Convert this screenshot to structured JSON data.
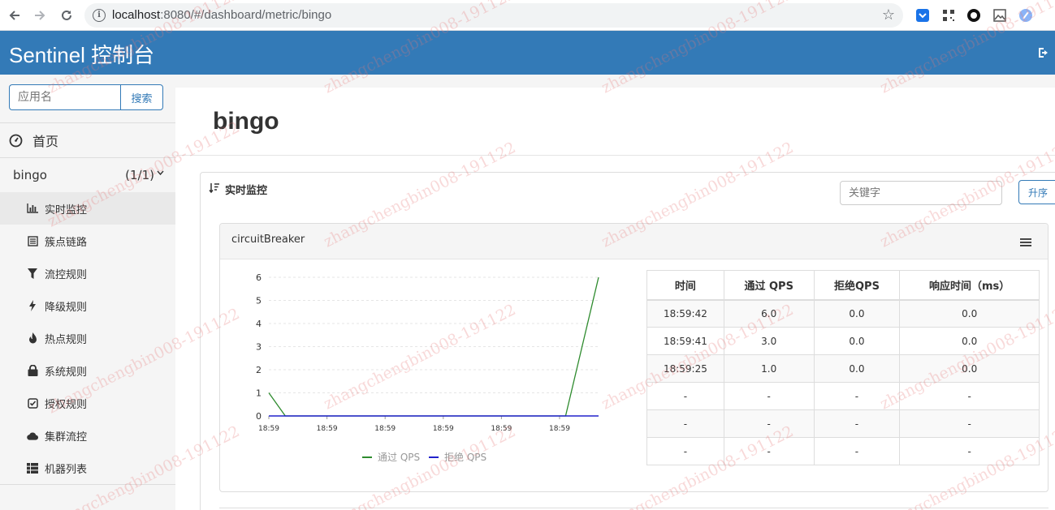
{
  "browser": {
    "url_host": "localhost",
    "url_rest": ":8080/#/dashboard/metric/bingo"
  },
  "header": {
    "title": "Sentinel 控制台"
  },
  "sidebar": {
    "search_placeholder": "应用名",
    "search_button": "搜索",
    "home_label": "首页",
    "app_name": "bingo",
    "app_count": "(1/1)",
    "menu": [
      {
        "label": "实时监控",
        "icon": "bar-chart-icon"
      },
      {
        "label": "簇点链路",
        "icon": "list-icon"
      },
      {
        "label": "流控规则",
        "icon": "filter-icon"
      },
      {
        "label": "降级规则",
        "icon": "flash-icon"
      },
      {
        "label": "热点规则",
        "icon": "fire-icon"
      },
      {
        "label": "系统规则",
        "icon": "lock-icon"
      },
      {
        "label": "授权规则",
        "icon": "check-icon"
      },
      {
        "label": "集群流控",
        "icon": "cloud-icon"
      },
      {
        "label": "机器列表",
        "icon": "th-list-icon"
      }
    ]
  },
  "main": {
    "page_title": "bingo",
    "panel_title": "实时监控",
    "keyword_placeholder": "关键字",
    "asc_button": "升序",
    "resource_name": "circuitBreaker",
    "table": {
      "headers": [
        "时间",
        "通过 QPS",
        "拒绝QPS",
        "响应时间（ms）"
      ],
      "rows": [
        [
          "18:59:42",
          "6.0",
          "0.0",
          "0.0"
        ],
        [
          "18:59:41",
          "3.0",
          "0.0",
          "0.0"
        ],
        [
          "18:59:25",
          "1.0",
          "0.0",
          "0.0"
        ],
        [
          "-",
          "-",
          "-",
          "-"
        ],
        [
          "-",
          "-",
          "-",
          "-"
        ],
        [
          "-",
          "-",
          "-",
          "-"
        ]
      ]
    }
  },
  "watermark": "zhangchengbin008-191122",
  "colors": {
    "header": "#337ab7",
    "pass_series": "#2e8b2e",
    "block_series": "#2222cc"
  },
  "chart_data": {
    "type": "line",
    "x": [
      0,
      1,
      2,
      3,
      4,
      5,
      6,
      7,
      8,
      9,
      10,
      11,
      12,
      13,
      14,
      15,
      16,
      17,
      18,
      19,
      20
    ],
    "tick_labels": [
      "18:59",
      "18:59",
      "18:59",
      "18:59",
      "18:59",
      "18:59"
    ],
    "ylim": [
      0,
      6
    ],
    "yticks": [
      0,
      1,
      2,
      3,
      4,
      5,
      6
    ],
    "series": [
      {
        "name": "通过 QPS",
        "color": "#2e8b2e",
        "values": [
          1,
          0,
          0,
          0,
          0,
          0,
          0,
          0,
          0,
          0,
          0,
          0,
          0,
          0,
          0,
          0,
          0,
          0,
          0,
          3,
          6
        ]
      },
      {
        "name": "拒绝 QPS",
        "color": "#2222cc",
        "values": [
          0,
          0,
          0,
          0,
          0,
          0,
          0,
          0,
          0,
          0,
          0,
          0,
          0,
          0,
          0,
          0,
          0,
          0,
          0,
          0,
          0
        ]
      }
    ],
    "grid": true,
    "legend": "bottom"
  }
}
